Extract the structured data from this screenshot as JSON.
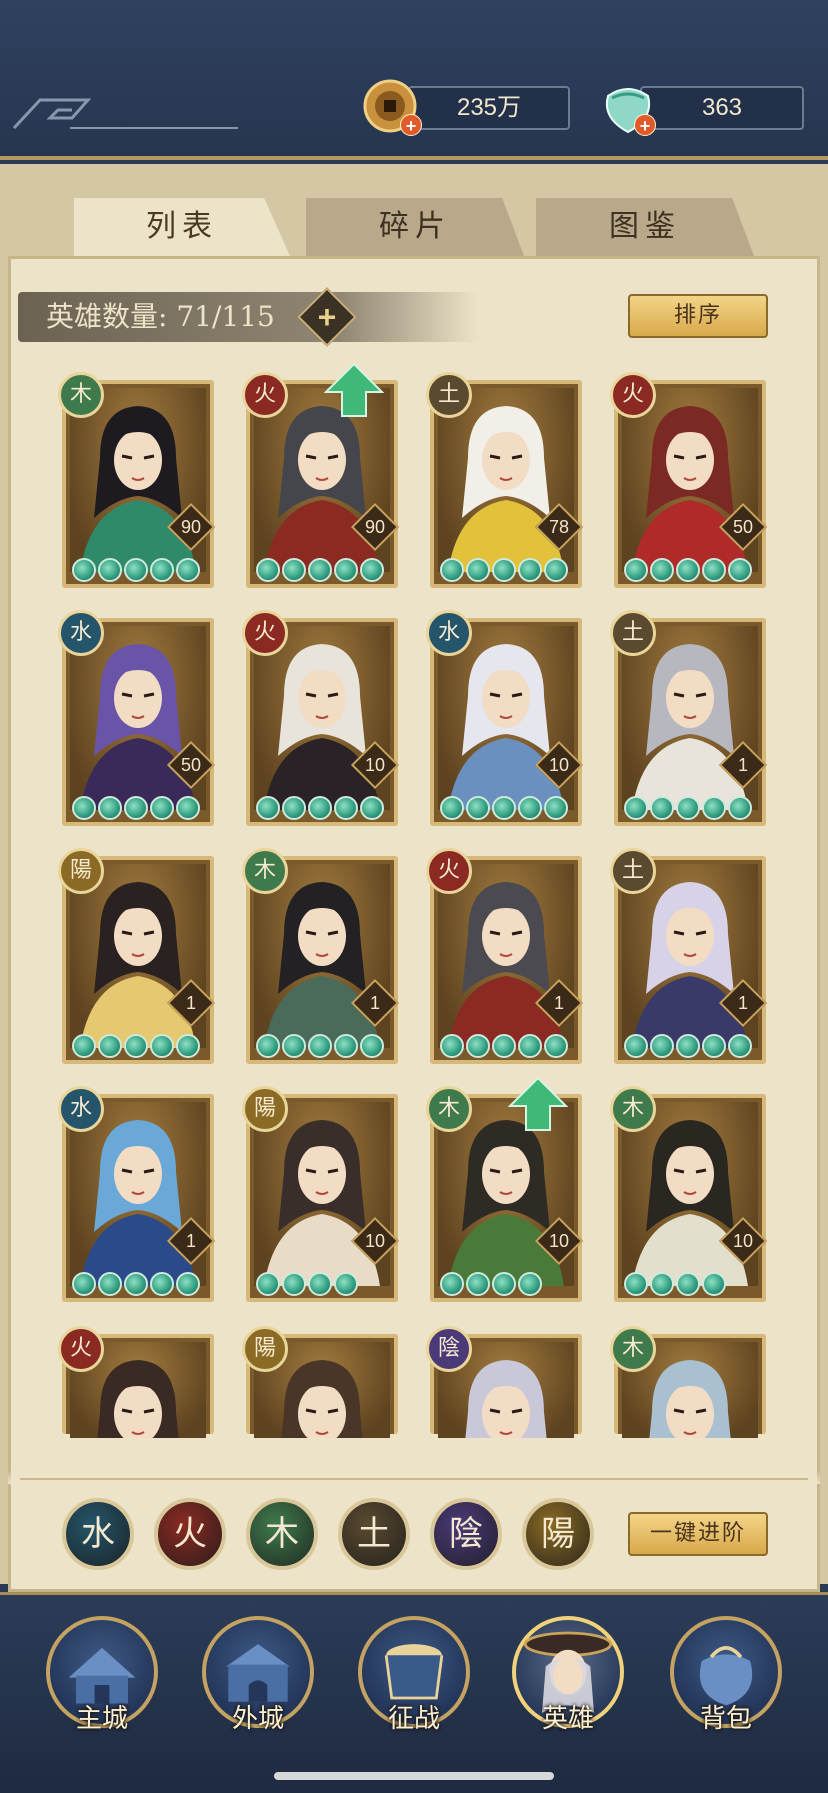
{
  "header": {
    "coins": "235万",
    "jade": "363",
    "plus": "+"
  },
  "tabs": [
    {
      "label": "列表",
      "active": true
    },
    {
      "label": "碎片",
      "active": false
    },
    {
      "label": "图鉴",
      "active": false
    }
  ],
  "hero_count": "英雄数量: 71/115",
  "count_add": "+",
  "sort_button": "排序",
  "elements": {
    "wood": {
      "glyph": "木",
      "color": "#3f7a4c"
    },
    "fire": {
      "glyph": "火",
      "color": "#8a2a22"
    },
    "earth": {
      "glyph": "土",
      "color": "#5a4a30"
    },
    "water": {
      "glyph": "水",
      "color": "#24556a"
    },
    "yang": {
      "glyph": "陽",
      "color": "#8a6a24"
    },
    "yin": {
      "glyph": "陰",
      "color": "#4a3a78"
    }
  },
  "heroes": [
    {
      "element": "wood",
      "glyph": "木",
      "level": "90",
      "stars": 5,
      "upgrade": false,
      "color": "#3f7a4c"
    },
    {
      "element": "fire",
      "glyph": "火",
      "level": "90",
      "stars": 5,
      "upgrade": true,
      "color": "#8a2a22"
    },
    {
      "element": "earth",
      "glyph": "土",
      "level": "78",
      "stars": 5,
      "upgrade": false,
      "color": "#5a4a30"
    },
    {
      "element": "fire",
      "glyph": "火",
      "level": "50",
      "stars": 5,
      "upgrade": false,
      "color": "#8a2a22"
    },
    {
      "element": "water",
      "glyph": "水",
      "level": "50",
      "stars": 5,
      "upgrade": false,
      "color": "#24556a"
    },
    {
      "element": "fire",
      "glyph": "火",
      "level": "10",
      "stars": 5,
      "upgrade": false,
      "color": "#8a2a22"
    },
    {
      "element": "water",
      "glyph": "水",
      "level": "10",
      "stars": 5,
      "upgrade": false,
      "color": "#24556a"
    },
    {
      "element": "earth",
      "glyph": "土",
      "level": "1",
      "stars": 5,
      "upgrade": false,
      "color": "#5a4a30"
    },
    {
      "element": "yang",
      "glyph": "陽",
      "level": "1",
      "stars": 5,
      "upgrade": false,
      "color": "#8a6a24"
    },
    {
      "element": "wood",
      "glyph": "木",
      "level": "1",
      "stars": 5,
      "upgrade": false,
      "color": "#3f7a4c"
    },
    {
      "element": "fire",
      "glyph": "火",
      "level": "1",
      "stars": 5,
      "upgrade": false,
      "color": "#8a2a22"
    },
    {
      "element": "earth",
      "glyph": "土",
      "level": "1",
      "stars": 5,
      "upgrade": false,
      "color": "#5a4a30"
    },
    {
      "element": "water",
      "glyph": "水",
      "level": "1",
      "stars": 5,
      "upgrade": false,
      "color": "#24556a"
    },
    {
      "element": "yang",
      "glyph": "陽",
      "level": "10",
      "stars": 4,
      "upgrade": false,
      "color": "#8a6a24"
    },
    {
      "element": "wood",
      "glyph": "木",
      "level": "10",
      "stars": 4,
      "upgrade": true,
      "color": "#3f7a4c"
    },
    {
      "element": "wood",
      "glyph": "木",
      "level": "10",
      "stars": 4,
      "upgrade": false,
      "color": "#3f7a4c"
    },
    {
      "element": "fire",
      "glyph": "火",
      "level": "",
      "stars": 0,
      "upgrade": false,
      "color": "#8a2a22"
    },
    {
      "element": "yang",
      "glyph": "陽",
      "level": "",
      "stars": 0,
      "upgrade": false,
      "color": "#8a6a24"
    },
    {
      "element": "yin",
      "glyph": "陰",
      "level": "",
      "stars": 0,
      "upgrade": false,
      "color": "#4a3a78"
    },
    {
      "element": "wood",
      "glyph": "木",
      "level": "",
      "stars": 0,
      "upgrade": false,
      "color": "#3f7a4c"
    }
  ],
  "filters": [
    {
      "glyph": "水",
      "color": "#24556a"
    },
    {
      "glyph": "火",
      "color": "#8a2a22"
    },
    {
      "glyph": "木",
      "color": "#3f7a4c"
    },
    {
      "glyph": "土",
      "color": "#5a4a30"
    },
    {
      "glyph": "陰",
      "color": "#4a3a78"
    },
    {
      "glyph": "陽",
      "color": "#8a6a24"
    }
  ],
  "advance_button": "一键进阶",
  "nav": [
    {
      "label": "主城",
      "icon": "palace-icon"
    },
    {
      "label": "外城",
      "icon": "city-gate-icon"
    },
    {
      "label": "征战",
      "icon": "battle-drum-icon"
    },
    {
      "label": "英雄",
      "icon": "hero-portrait-icon",
      "active": true
    },
    {
      "label": "背包",
      "icon": "bag-icon"
    }
  ]
}
